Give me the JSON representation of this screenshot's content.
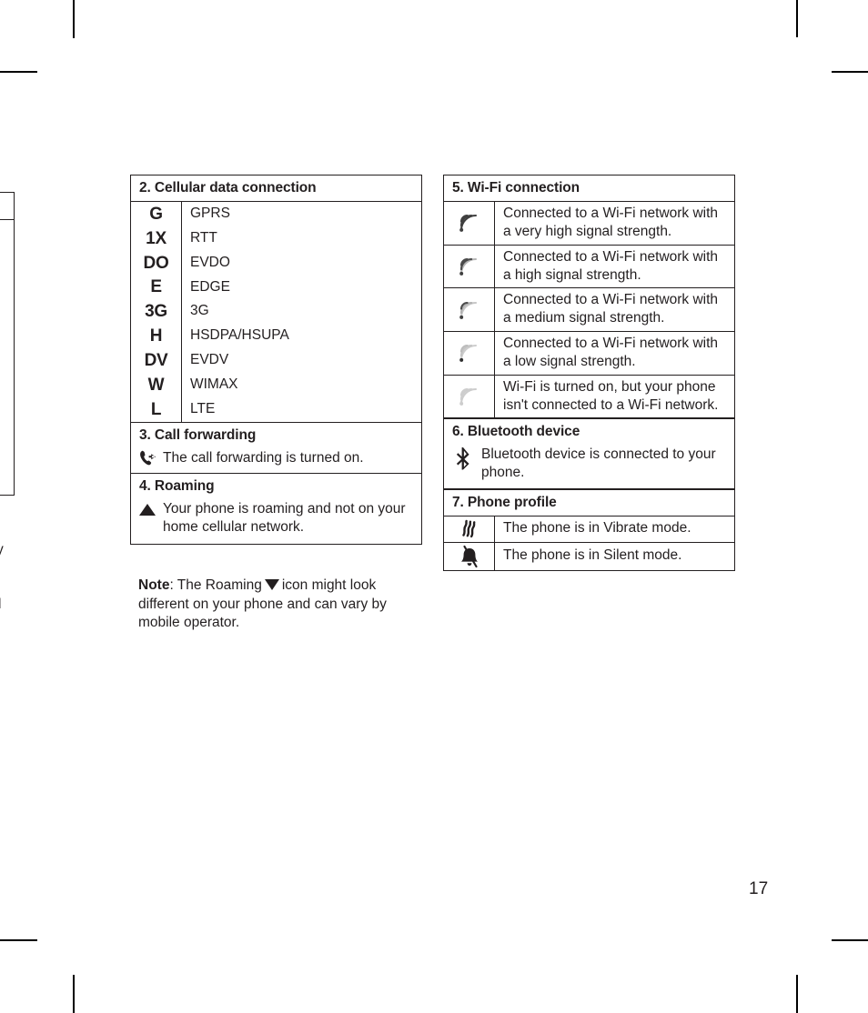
{
  "page": {
    "number": "17"
  },
  "bleed": {
    "fragment_1": "y",
    "fragment_2": "l"
  },
  "sections": [
    {
      "id": "cellular-data-connection",
      "heading": "2. Cellular data connection",
      "rows": [
        {
          "glyph": "G",
          "icon": "cellular-g-icon",
          "text": "GPRS"
        },
        {
          "glyph": "1X",
          "icon": "cellular-1x-icon",
          "text": "RTT"
        },
        {
          "glyph": "DO",
          "icon": "cellular-do-icon",
          "text": "EVDO"
        },
        {
          "glyph": "E",
          "icon": "cellular-e-icon",
          "text": "EDGE"
        },
        {
          "glyph": "3G",
          "icon": "cellular-3g-icon",
          "text": "3G"
        },
        {
          "glyph": "H",
          "icon": "cellular-h-icon",
          "text": "HSDPA/HSUPA"
        },
        {
          "glyph": "DV",
          "icon": "cellular-dv-icon",
          "text": "EVDV"
        },
        {
          "glyph": "W",
          "icon": "cellular-w-icon",
          "text": "WIMAX"
        },
        {
          "glyph": "L",
          "icon": "cellular-l-icon",
          "text": "LTE"
        }
      ]
    },
    {
      "id": "call-forwarding",
      "heading": "3. Call forwarding",
      "icon": "call-forwarding-icon",
      "text": "The call forwarding is turned on."
    },
    {
      "id": "roaming",
      "heading": "4. Roaming",
      "icon": "roaming-triangle-up-icon",
      "text": "Your phone is roaming and not on your home cellular network."
    },
    {
      "id": "wifi-connection",
      "heading": "5. Wi-Fi connection",
      "rows": [
        {
          "icon": "wifi-signal-very-high-icon",
          "level": 4,
          "text": "Connected to a Wi-Fi network with a very high signal strength."
        },
        {
          "icon": "wifi-signal-high-icon",
          "level": 3,
          "text": "Connected to a Wi-Fi network with a high signal strength."
        },
        {
          "icon": "wifi-signal-medium-icon",
          "level": 2,
          "text": "Connected to a Wi-Fi network with a medium signal strength."
        },
        {
          "icon": "wifi-signal-low-icon",
          "level": 1,
          "text": "Connected to a Wi-Fi network with a low signal strength."
        },
        {
          "icon": "wifi-not-connected-icon",
          "level": 0,
          "text": "Wi-Fi is turned on, but your phone isn't connected to a Wi-Fi network."
        }
      ]
    },
    {
      "id": "bluetooth-device",
      "heading": "6. Bluetooth device",
      "icon": "bluetooth-icon",
      "text": "Bluetooth device is connected to your phone."
    },
    {
      "id": "phone-profile",
      "heading": "7. Phone profile",
      "rows": [
        {
          "icon": "vibrate-icon",
          "text": "The phone is in Vibrate mode."
        },
        {
          "icon": "silent-bell-icon",
          "text": "The phone is in Silent mode."
        }
      ]
    }
  ],
  "note": {
    "label": "Note",
    "part_1": ": The Roaming",
    "part_2": "icon might look different on your phone and can vary by mobile operator."
  },
  "colors": {
    "ink": "#231f20",
    "rule": "#231f20",
    "wifi_strong": "#3a3a3a",
    "wifi_weak": "#c9c9c9"
  }
}
